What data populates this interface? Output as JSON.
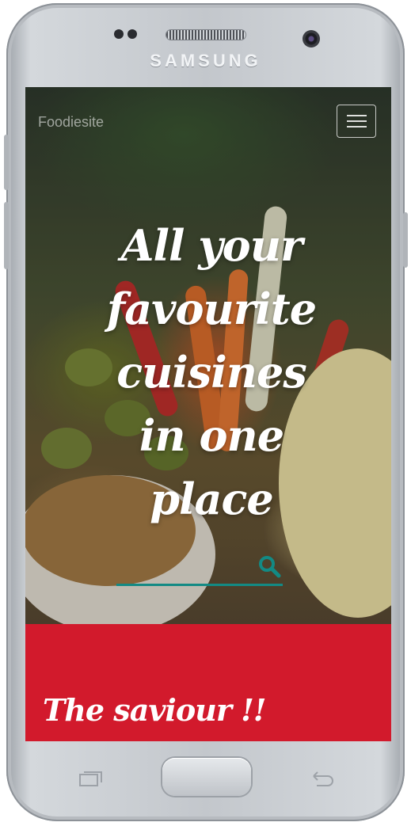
{
  "device": {
    "brand": "SAMSUNG"
  },
  "header": {
    "brand": "Foodiesite",
    "menu_icon": "hamburger-icon"
  },
  "hero": {
    "headline": "All your favourite cuisines in one place",
    "search": {
      "value": "",
      "placeholder": "",
      "icon": "search-icon"
    }
  },
  "section": {
    "title": "The saviour !!"
  },
  "colors": {
    "accent": "#138a84",
    "band": "#d21a2c",
    "text_light": "#ffffff"
  }
}
